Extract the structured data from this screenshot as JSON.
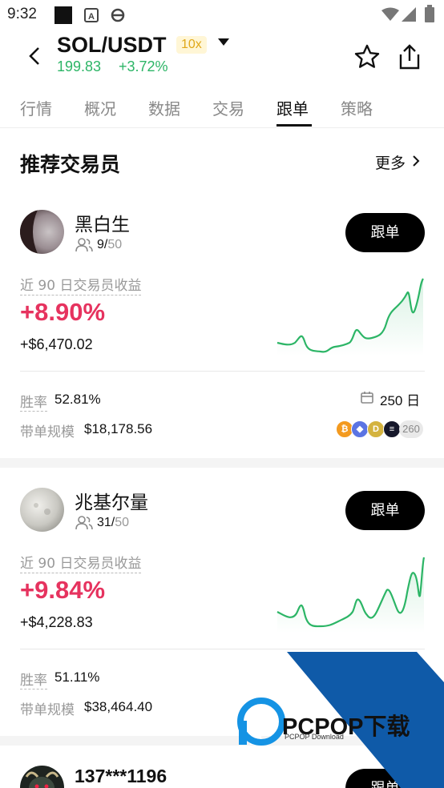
{
  "status_bar": {
    "time": "9:32"
  },
  "header": {
    "pair": "SOL/USDT",
    "leverage": "10x",
    "price": "199.83",
    "change": "+3.72%"
  },
  "tabs": [
    {
      "label": "行情"
    },
    {
      "label": "概况"
    },
    {
      "label": "数据"
    },
    {
      "label": "交易"
    },
    {
      "label": "跟单",
      "active": true
    },
    {
      "label": "策略"
    }
  ],
  "section": {
    "title": "推荐交易员",
    "more": "更多"
  },
  "traders": [
    {
      "name": "黑白生",
      "followers": "9",
      "max_followers": "50",
      "follow_label": "跟单",
      "pl_label": "近 90 日交易员收益",
      "pl_pct": "+8.90%",
      "pl_amount": "+$6,470.02",
      "win_rate_label": "胜率",
      "win_rate": "52.81%",
      "aum_label": "带单规模",
      "aum": "$18,178.56",
      "days": "250 日",
      "coins_more": "260",
      "coins": [
        "bitcoin",
        "ethereum",
        "dogecoin",
        "solana"
      ]
    },
    {
      "name": "兆基尔量",
      "followers": "31",
      "max_followers": "50",
      "follow_label": "跟单",
      "pl_label": "近 90 日交易员收益",
      "pl_pct": "+9.84%",
      "pl_amount": "+$4,228.83",
      "win_rate_label": "胜率",
      "win_rate": "51.11%",
      "aum_label": "带单规模",
      "aum": "$38,464.40"
    },
    {
      "name": "137***1196",
      "follow_label": "跟单"
    }
  ],
  "colors": {
    "up_green": "#2cb566",
    "profit_red": "#e6335f",
    "leverage_bg": "#fff6d6",
    "leverage_text": "#e0a81a",
    "watermark_blue": "#0f5aa8"
  },
  "watermark": {
    "text": "PCPOP下载",
    "sub": "PCPOP Download"
  }
}
